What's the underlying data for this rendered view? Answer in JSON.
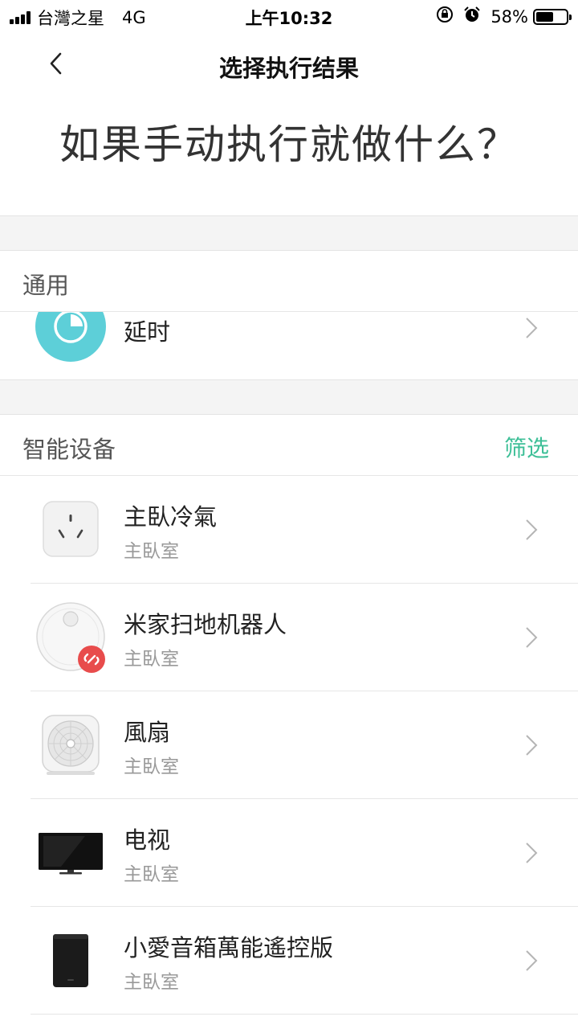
{
  "status_bar": {
    "carrier": "台灣之星",
    "network": "4G",
    "time": "上午10:32",
    "battery": "58%",
    "battery_level": 0.58
  },
  "nav": {
    "title": "选择执行结果"
  },
  "headline": "如果手动执行就做什么？",
  "general_section": {
    "label": "通用",
    "items": [
      {
        "name": "延时",
        "icon": "timer-icon"
      }
    ]
  },
  "devices_section": {
    "label": "智能设备",
    "filter_label": "筛选",
    "items": [
      {
        "name": "主臥冷氣",
        "room": "主臥室",
        "icon": "smart-plug-icon"
      },
      {
        "name": "米家扫地机器人",
        "room": "主臥室",
        "icon": "robot-vacuum-icon"
      },
      {
        "name": "風扇",
        "room": "主臥室",
        "icon": "fan-icon"
      },
      {
        "name": "电视",
        "room": "主臥室",
        "icon": "tv-icon"
      },
      {
        "name": "小愛音箱萬能遙控版",
        "room": "主臥室",
        "icon": "speaker-icon"
      }
    ]
  },
  "colors": {
    "accent": "#3dbf97",
    "timer": "#5dcfd8",
    "offline_badge": "#e84c4c"
  }
}
